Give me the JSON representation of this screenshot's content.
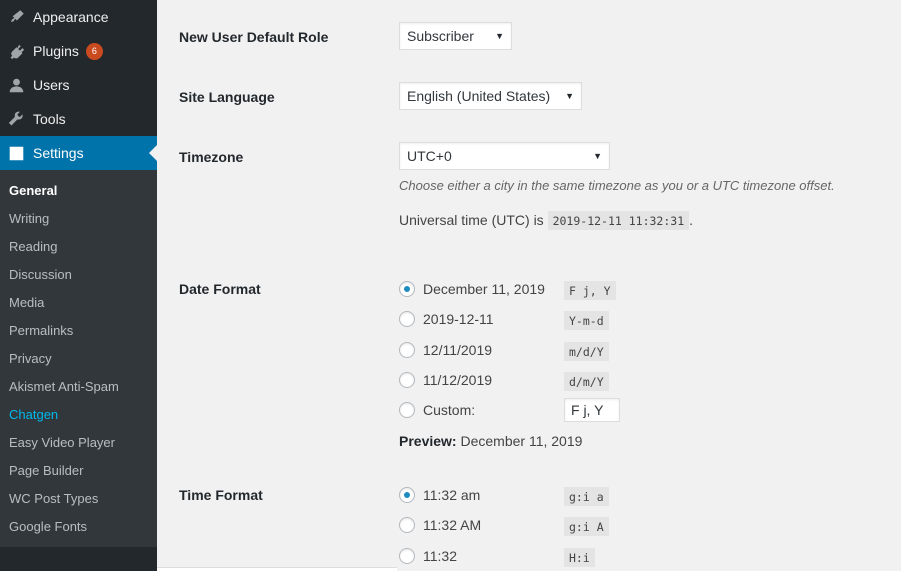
{
  "sidebar": {
    "menu": [
      {
        "label": "Appearance",
        "icon": "paintbrush-icon"
      },
      {
        "label": "Plugins",
        "icon": "plugin-icon",
        "badge": "6"
      },
      {
        "label": "Users",
        "icon": "users-icon"
      },
      {
        "label": "Tools",
        "icon": "wrench-icon"
      },
      {
        "label": "Settings",
        "icon": "settings-icon",
        "active": true
      }
    ],
    "submenu": [
      "General",
      "Writing",
      "Reading",
      "Discussion",
      "Media",
      "Permalinks",
      "Privacy",
      "Akismet Anti-Spam",
      "Chatgen",
      "Easy Video Player",
      "Page Builder",
      "WC Post Types",
      "Google Fonts"
    ]
  },
  "settings": {
    "default_role": {
      "label": "New User Default Role",
      "value": "Subscriber"
    },
    "site_language": {
      "label": "Site Language",
      "value": "English (United States)"
    },
    "timezone": {
      "label": "Timezone",
      "value": "UTC+0",
      "description": "Choose either a city in the same timezone as you or a UTC timezone offset.",
      "utc_prefix": "Universal time (UTC) is",
      "utc_value": "2019-12-11 11:32:31",
      "utc_suffix": "."
    },
    "date_format": {
      "label": "Date Format",
      "options": [
        {
          "text": "December 11, 2019",
          "code": "F j, Y",
          "checked": true
        },
        {
          "text": "2019-12-11",
          "code": "Y-m-d",
          "checked": false
        },
        {
          "text": "12/11/2019",
          "code": "m/d/Y",
          "checked": false
        },
        {
          "text": "11/12/2019",
          "code": "d/m/Y",
          "checked": false
        }
      ],
      "custom_label": "Custom:",
      "custom_value": "F j, Y",
      "preview_label": "Preview:",
      "preview_value": "December 11, 2019"
    },
    "time_format": {
      "label": "Time Format",
      "options": [
        {
          "text": "11:32 am",
          "code": "g:i a",
          "checked": true
        },
        {
          "text": "11:32 AM",
          "code": "g:i A",
          "checked": false
        },
        {
          "text": "11:32",
          "code": "H:i",
          "checked": false
        }
      ]
    }
  },
  "colors": {
    "accent": "#0073aa",
    "sidebar": "#23282d",
    "submenu": "#32373c",
    "badge": "#ca4a1f",
    "highlight": "#00b9eb"
  }
}
